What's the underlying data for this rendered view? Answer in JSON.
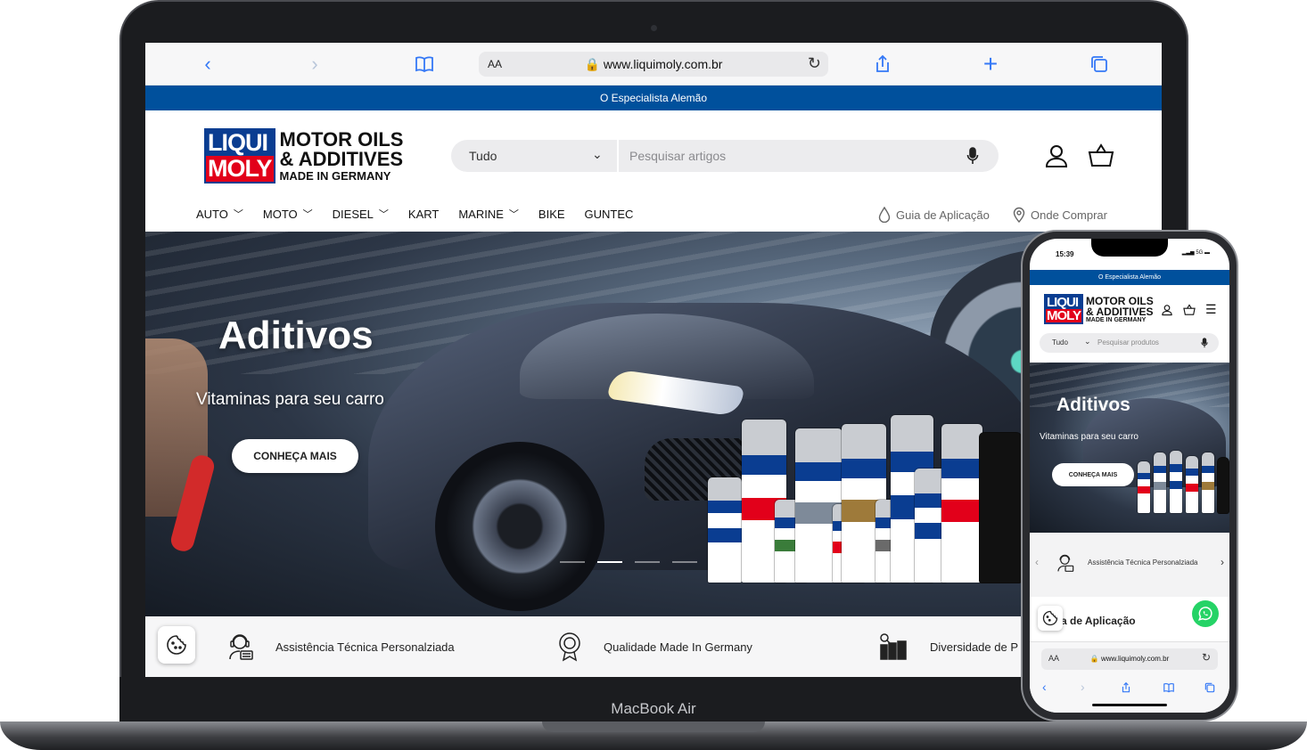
{
  "browser": {
    "url": "www.liquimoly.com.br",
    "aa_label": "AA"
  },
  "site": {
    "topbar_text": "O Especialista Alemão",
    "logo": {
      "line1": "LIQUI",
      "line2": "MOLY",
      "tag1": "MOTOR OILS",
      "tag2": "& ADDITIVES",
      "tag3": "MADE IN GERMANY"
    },
    "search": {
      "category": "Tudo",
      "placeholder": "Pesquisar artigos"
    },
    "nav": {
      "auto": "AUTO",
      "moto": "MOTO",
      "diesel": "DIESEL",
      "kart": "KART",
      "marine": "MARINE",
      "bike": "BIKE",
      "guntec": "GUNTEC",
      "guide": "Guia de Aplicação",
      "where": "Onde Comprar"
    },
    "hero": {
      "title": "Aditivos",
      "subtitle": "Vitaminas para seu carro",
      "cta": "CONHEÇA MAIS"
    },
    "features": [
      "Assistência Técnica Personalziada",
      "Qualidade Made In Germany",
      "Diversidade de P"
    ]
  },
  "laptop": {
    "brand": "MacBook Air"
  },
  "phone": {
    "time": "15:39",
    "signal": "5G",
    "search_category": "Tudo",
    "search_placeholder": "Pesquisar produtos",
    "feature_text": "Assistência Técnica Personalziada",
    "guide_text": "a de Aplicação",
    "url": "www.liquimoly.com.br",
    "aa_label": "AA"
  },
  "colors": {
    "brand_blue": "#00509c",
    "logo_red": "#e2001a",
    "safari_blue": "#3478f6",
    "whatsapp": "#25d366"
  }
}
